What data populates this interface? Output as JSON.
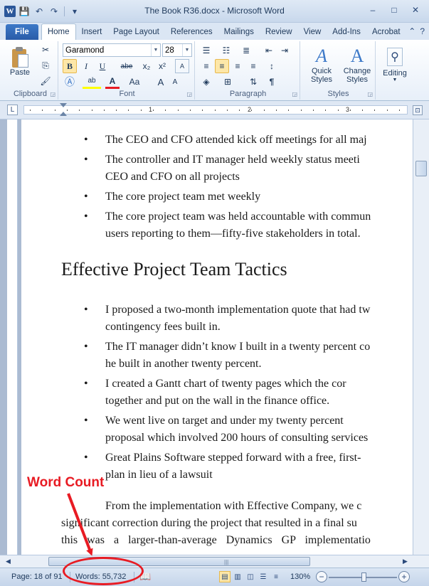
{
  "window": {
    "title": "The Book R36.docx  -  Microsoft Word",
    "app_icon_letter": "W",
    "controls": {
      "minimize": "–",
      "maximize": "□",
      "close": "✕"
    }
  },
  "qat": {
    "save": "💾",
    "undo": "↶",
    "redo": "↷",
    "customize": "▾"
  },
  "tabs": [
    {
      "label": "File"
    },
    {
      "label": "Home"
    },
    {
      "label": "Insert"
    },
    {
      "label": "Page Layout"
    },
    {
      "label": "References"
    },
    {
      "label": "Mailings"
    },
    {
      "label": "Review"
    },
    {
      "label": "View"
    },
    {
      "label": "Add-Ins"
    },
    {
      "label": "Acrobat"
    }
  ],
  "ribbon": {
    "clipboard": {
      "label": "Clipboard",
      "paste_label": "Paste"
    },
    "font": {
      "label": "Font",
      "font_name": "Garamond",
      "font_size": "28",
      "bold": "B",
      "italic": "I",
      "underline": "U",
      "strike": "abe",
      "subscript": "x₂",
      "superscript": "x²",
      "grow": "A",
      "shrink": "A",
      "change_case": "Aa",
      "clear": "A",
      "highlight": "ab",
      "font_color": "A"
    },
    "paragraph": {
      "label": "Paragraph",
      "show_marks": "¶"
    },
    "styles": {
      "label": "Styles",
      "quick_styles_line1": "Quick",
      "quick_styles_line2": "Styles",
      "change_styles_line1": "Change",
      "change_styles_line2": "Styles"
    },
    "editing": {
      "label": "Editing"
    }
  },
  "ruler": {
    "marks": [
      "1",
      "2",
      "3"
    ]
  },
  "document": {
    "bullets_top": [
      {
        "lines": [
          "The CEO and CFO attended kick off meetings for all maj"
        ]
      },
      {
        "lines": [
          "The controller and IT manager held weekly status meeti",
          "CEO and CFO on all projects"
        ]
      },
      {
        "lines": [
          "The core project team met weekly"
        ]
      },
      {
        "lines": [
          "The core project team was held accountable with commun",
          "users reporting to them—fifty-five stakeholders in total."
        ]
      }
    ],
    "heading": "Effective Project Team Tactics",
    "bullets_bottom": [
      {
        "lines": [
          "I proposed a two-month implementation quote that had tw",
          "contingency fees built in."
        ]
      },
      {
        "lines": [
          "The IT manager didn’t know I built in a twenty percent co",
          "he built in another twenty percent."
        ]
      },
      {
        "lines": [
          "I created a Gantt chart of twenty pages which the cor",
          "together and put on the wall in the finance office."
        ]
      },
      {
        "lines": [
          "We went live on target and under my twenty percent",
          "proposal which involved 200 hours of consulting services"
        ]
      },
      {
        "lines": [
          "Great Plains Software stepped forward with a free, first-",
          "plan in lieu of a lawsuit"
        ]
      }
    ],
    "paragraph_lines": [
      "From the implementation with Effective Company, we c",
      "significant correction during the project that resulted in a final su",
      "this was a larger-than-average Dynamics GP implementatio"
    ]
  },
  "statusbar": {
    "page": "Page: 18 of 91",
    "words": "Words: 55,732",
    "zoom": "130%",
    "zoom_minus": "−",
    "zoom_plus": "+"
  },
  "annotation": {
    "label": "Word Count",
    "color": "#e81b23"
  }
}
